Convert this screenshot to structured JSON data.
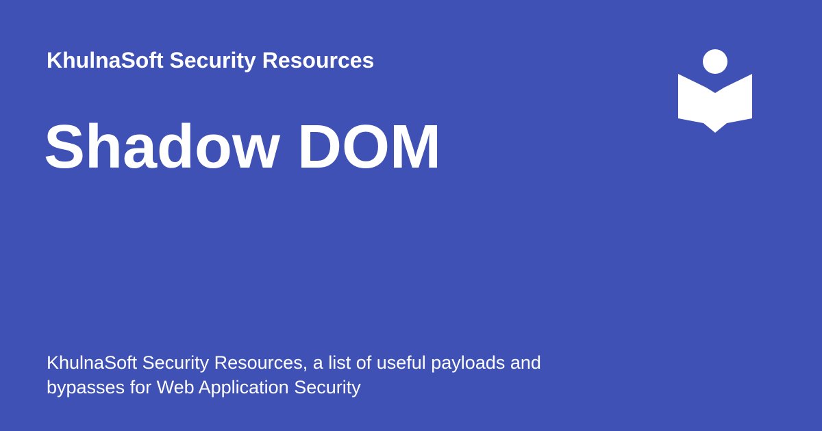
{
  "theme": {
    "background": "#3f51b5",
    "foreground": "#ffffff"
  },
  "site": {
    "name": "KhulnaSoft Security Resources",
    "logo_icon": "reader-book-icon"
  },
  "page": {
    "title": "Shadow DOM",
    "description": "KhulnaSoft Security Resources, a list of useful payloads and bypasses for Web Application Security"
  }
}
